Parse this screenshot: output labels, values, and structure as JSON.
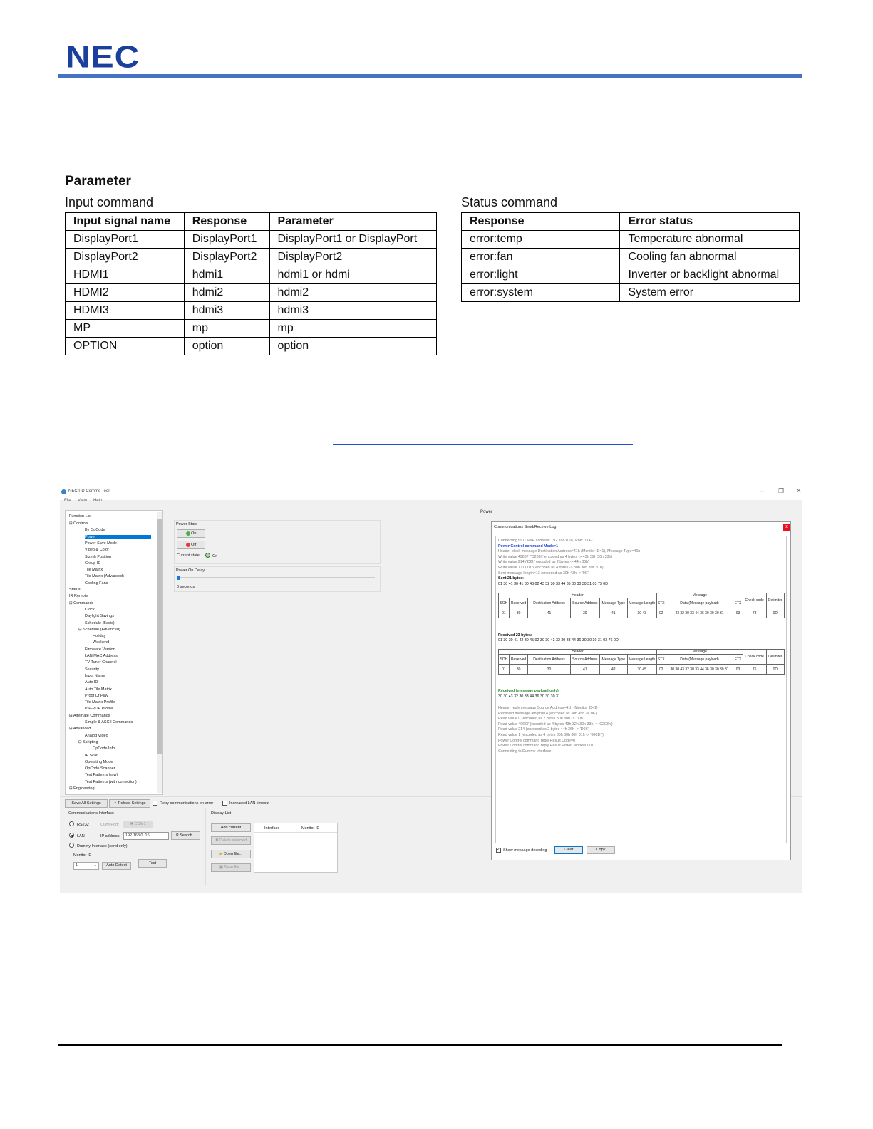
{
  "header": {
    "logo": "NEC"
  },
  "section_title": "Parameter",
  "input_command": {
    "title": "Input command",
    "headers": [
      "Input signal name",
      "Response",
      "Parameter"
    ],
    "rows": [
      [
        "DisplayPort1",
        "DisplayPort1",
        "DisplayPort1 or DisplayPort"
      ],
      [
        "DisplayPort2",
        "DisplayPort2",
        "DisplayPort2"
      ],
      [
        "HDMI1",
        "hdmi1",
        "hdmi1 or hdmi"
      ],
      [
        "HDMI2",
        "hdmi2",
        "hdmi2"
      ],
      [
        "HDMI3",
        "hdmi3",
        "hdmi3"
      ],
      [
        "MP",
        "mp",
        "mp"
      ],
      [
        "OPTION",
        "option",
        "option"
      ]
    ]
  },
  "status_command": {
    "title": "Status command",
    "headers": [
      "Response",
      "Error status"
    ],
    "rows": [
      [
        "error:temp",
        "Temperature abnormal"
      ],
      [
        "error:fan",
        "Cooling fan abnormal"
      ],
      [
        "error:light",
        "Inverter or backlight abnormal"
      ],
      [
        "error:system",
        "System error"
      ]
    ]
  },
  "app": {
    "title": "NEC PD Comms Tool",
    "menu": [
      "File",
      "View",
      "Help"
    ],
    "window_controls": [
      "–",
      "❐",
      "✕"
    ],
    "page_label": "Power",
    "function_list": {
      "title": "Function List",
      "items": [
        {
          "label": "Controls",
          "level": 1,
          "expander": "⊟"
        },
        {
          "label": "By OpCode",
          "level": 2
        },
        {
          "label": "Power",
          "level": 2,
          "selected": true
        },
        {
          "label": "Power Save Mode",
          "level": 2
        },
        {
          "label": "Video & Color",
          "level": 2
        },
        {
          "label": "Size & Position",
          "level": 2
        },
        {
          "label": "Group ID",
          "level": 2
        },
        {
          "label": "Tile Matrix",
          "level": 2
        },
        {
          "label": "Tile Matrix (Advanced)",
          "level": 2
        },
        {
          "label": "Cooling Fans",
          "level": 2
        },
        {
          "label": "Status",
          "level": 1
        },
        {
          "label": "IR Remote",
          "level": 1
        },
        {
          "label": "Commands",
          "level": 1,
          "expander": "⊟"
        },
        {
          "label": "Clock",
          "level": 2
        },
        {
          "label": "Daylight Savings",
          "level": 2
        },
        {
          "label": "Schedule (Basic)",
          "level": 2
        },
        {
          "label": "Schedule (Advanced)",
          "level": 2,
          "expander": "⊟"
        },
        {
          "label": "Holiday",
          "level": 3
        },
        {
          "label": "Weekend",
          "level": 3
        },
        {
          "label": "Firmware Version",
          "level": 2
        },
        {
          "label": "LAN MAC Address",
          "level": 2
        },
        {
          "label": "TV Tuner Channel",
          "level": 2
        },
        {
          "label": "Security",
          "level": 2
        },
        {
          "label": "Input Name",
          "level": 2
        },
        {
          "label": "Auto ID",
          "level": 2
        },
        {
          "label": "Auto Tile Matrix",
          "level": 2
        },
        {
          "label": "Proof Of Play",
          "level": 2
        },
        {
          "label": "Tile Matrix Profile",
          "level": 2
        },
        {
          "label": "PIP-POP Profile",
          "level": 2
        },
        {
          "label": "Alternate Commands",
          "level": 1,
          "expander": "⊟"
        },
        {
          "label": "Simple & ASCII Commands",
          "level": 2
        },
        {
          "label": "Advanced",
          "level": 1,
          "expander": "⊟"
        },
        {
          "label": "Analog Video",
          "level": 2
        },
        {
          "label": "Scripting",
          "level": 2,
          "expander": "⊟"
        },
        {
          "label": "OpCode Info",
          "level": 3
        },
        {
          "label": "IP Scan",
          "level": 2
        },
        {
          "label": "Operating Mode",
          "level": 2
        },
        {
          "label": "OpCode Scanner",
          "level": 2
        },
        {
          "label": "Test Patterns (raw)",
          "level": 2
        },
        {
          "label": "Test Patterns (with correction)",
          "level": 2
        },
        {
          "label": "Engineering",
          "level": 1,
          "expander": "⊟"
        }
      ]
    },
    "power_state": {
      "title": "Power State",
      "on_label": "On",
      "off_label": "Off",
      "current_state_label": "Current state:",
      "current_state_value": "On"
    },
    "power_on_delay": {
      "title": "Power On Delay",
      "value_label": "0 seconds",
      "level": 0.0
    },
    "bottom_bar": {
      "save_all": "Save All Settings",
      "reload": "Reload Settings",
      "retry": "Retry communications on error",
      "increased_timeout": "Increased LAN timeout"
    },
    "comms_interface": {
      "title": "Communications Interface",
      "rs232": "RS232",
      "com_port_label": "COM Port:",
      "com_port_value": "COM1",
      "lan": "LAN",
      "ip_label": "IP address:",
      "ip_value": "192.168.0 .16",
      "search": "Search...",
      "dummy": "Dummy Interface (send only)",
      "monitor_id_label": "Monitor ID",
      "monitor_id_value": "1",
      "auto_detect": "Auto Detect",
      "test": "Test"
    },
    "display_list": {
      "title": "Display List",
      "add_current": "Add current",
      "delete_selected": "Delete selected",
      "open_file": "Open file...",
      "save_file": "Save file...",
      "columns": [
        "Interface",
        "Monitor ID"
      ]
    },
    "log": {
      "title": "Communications Send/Receive Log",
      "lines_top": [
        {
          "text": "Connecting to TCP/IP address: 192.168.0.16, Port: 7142",
          "style": "gray"
        },
        {
          "text": "Power Control command Mode=1",
          "style": "blue"
        },
        {
          "text": "Header block message Destination Address=41h (Monitor ID=1), Message Type=41h",
          "style": "gray"
        },
        {
          "text": "Write value 49667 ('C203h' encoded as 4 bytes -> 43h 32h 30h 33h)",
          "style": "gray"
        },
        {
          "text": "Write value 214 ('D6h' encoded as 2 bytes -> 44h 36h)",
          "style": "gray"
        },
        {
          "text": "Write value 1 ('0001h' encoded as 4 bytes -> 30h 30h 30h 31h)",
          "style": "gray"
        },
        {
          "text": "Sent message length=13 (encoded as 30h 43h -> '0C')",
          "style": "gray"
        },
        {
          "text": "Sent 21 bytes:",
          "style": "bold"
        },
        {
          "text": "01 30 41 30 41 30 43 02 43 32 30 33 44 36 30 30 30 31 03 73 0D",
          "style": "dark"
        }
      ],
      "received_label": "Received 23 bytes:",
      "received_bytes": "01 30 30 41 42 30 45 02 30 30 43 32 30 33 44 36 30 30 30 31 03 76 0D",
      "payload_label": "Received (message payload only):",
      "payload_bytes": "30 30 43 32 30 33 44 36 30 30 30 31",
      "lines_bottom": [
        "Header reply message Source Address=41h (Monitor ID=1)",
        "Received message length=14 (encoded as 30h 45h -> '0E')",
        "Read value 0 (encoded as 2 bytes 30h 30h -> '00h')",
        "Read value 49667 (encoded as 4 bytes 43h 32h 30h 33h -> 'C203h')",
        "Read value 214 (encoded as 2 bytes 44h 36h -> 'D6h')",
        "Read value 1 (encoded as 4 bytes 30h 30h 30h 31h -> '0001h')",
        "Power Control command reply Result Code=0",
        "Power Control command reply Result Power Mode=0001",
        "Connecting to Dummy Interface"
      ],
      "packet_headers": {
        "group_header": "Header",
        "group_message": "Message",
        "check": "Check code",
        "delim": "Delimiter",
        "cols": [
          "SOH",
          "Reserved",
          "Destination Address",
          "Source Address",
          "Message Type",
          "Message Length",
          "STX",
          "Data (Message payload)",
          "ETX"
        ]
      },
      "packet_sent": [
        "01",
        "30",
        "41",
        "30",
        "41",
        "30 43",
        "02",
        "43 32 30 33 44 36 30 30 30 31",
        "03",
        "73",
        "0D"
      ],
      "packet_received": [
        "01",
        "30",
        "30",
        "41",
        "42",
        "30 45",
        "02",
        "30 30 43 32 30 33 44 36 30 30 30 31",
        "03",
        "76",
        "0D"
      ],
      "show_decoding": "Show message decoding",
      "clear": "Clear",
      "copy": "Copy",
      "close": "x"
    }
  }
}
